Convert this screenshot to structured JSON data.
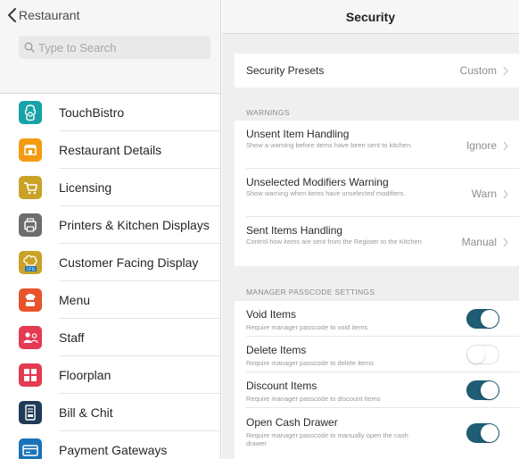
{
  "sidebar": {
    "back_label": "Restaurant",
    "search_placeholder": "Type to Search",
    "items": [
      {
        "label": "TouchBistro",
        "icon": "touchbistro-logo-icon",
        "color": "#17a2a6"
      },
      {
        "label": "Restaurant Details",
        "icon": "storefront-icon",
        "color": "#f39c12"
      },
      {
        "label": "Licensing",
        "icon": "shopping-cart-icon",
        "color": "#c9a227"
      },
      {
        "label": "Printers & Kitchen Displays",
        "icon": "printer-icon",
        "color": "#6d6d6d"
      },
      {
        "label": "Customer Facing Display",
        "icon": "chef-hat-cfd-icon",
        "color": "#c9a227"
      },
      {
        "label": "Menu",
        "icon": "chef-icon",
        "color": "#e8532c"
      },
      {
        "label": "Staff",
        "icon": "staff-people-icon",
        "color": "#e53a52"
      },
      {
        "label": "Floorplan",
        "icon": "floorplan-icon",
        "color": "#e53a52"
      },
      {
        "label": "Bill & Chit",
        "icon": "receipt-icon",
        "color": "#1f3b57"
      },
      {
        "label": "Payment Gateways",
        "icon": "payment-terminal-icon",
        "color": "#1a73b8"
      }
    ]
  },
  "header": {
    "title": "Security"
  },
  "presets": {
    "label": "Security Presets",
    "value": "Custom"
  },
  "warnings": {
    "header": "WARNINGS",
    "rows": [
      {
        "title": "Unsent Item Handling",
        "desc": "Show a warning before items have been sent to kitchen.",
        "value": "Ignore"
      },
      {
        "title": "Unselected Modifiers Warning",
        "desc": "Show warning when items have unselected modifiers.",
        "value": "Warn"
      },
      {
        "title": "Sent Items Handling",
        "desc": "Control how items are sent from the Register to the Kitchen",
        "value": "Manual"
      }
    ]
  },
  "manager": {
    "header": "MANAGER PASSCODE SETTINGS",
    "rows": [
      {
        "title": "Void Items",
        "desc": "Require manager passcode to void items",
        "enabled": true
      },
      {
        "title": "Delete Items",
        "desc": "Require manager passcode to delete items",
        "enabled": false
      },
      {
        "title": "Discount Items",
        "desc": "Require manager passcode to discount items",
        "enabled": true
      },
      {
        "title": "Open Cash Drawer",
        "desc": "Require manager passcode to manually open the cash drawer",
        "enabled": true
      }
    ]
  },
  "colors": {
    "toggle_on": "#1e5d73",
    "accent": "#1e5d73"
  }
}
